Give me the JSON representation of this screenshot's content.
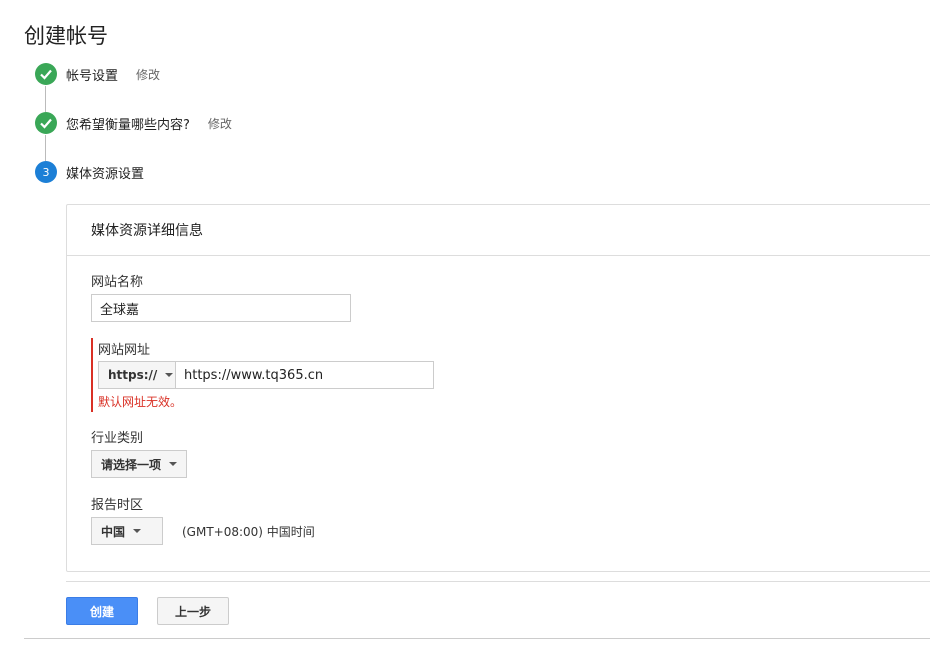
{
  "page": {
    "title": "创建帐号"
  },
  "steps": [
    {
      "label": "帐号设置",
      "edit": "修改",
      "status": "done"
    },
    {
      "label": "您希望衡量哪些内容?",
      "edit": "修改",
      "status": "done"
    },
    {
      "label": "媒体资源设置",
      "number": "3",
      "status": "active"
    }
  ],
  "card": {
    "title": "媒体资源详细信息",
    "site_name": {
      "label": "网站名称",
      "value": "全球嘉"
    },
    "site_url": {
      "label": "网站网址",
      "protocol": "https://",
      "value": "https://www.tq365.cn",
      "error": "默认网址无效。"
    },
    "industry": {
      "label": "行业类别",
      "selected": "请选择一项"
    },
    "timezone": {
      "label": "报告时区",
      "country": "中国",
      "zone": "(GMT+08:00) 中国时间"
    }
  },
  "actions": {
    "create": "创建",
    "back": "上一步"
  },
  "colors": {
    "done": "#3aa757",
    "active": "#1c7fd6",
    "primary": "#4a8ff7",
    "error": "#d93025"
  }
}
